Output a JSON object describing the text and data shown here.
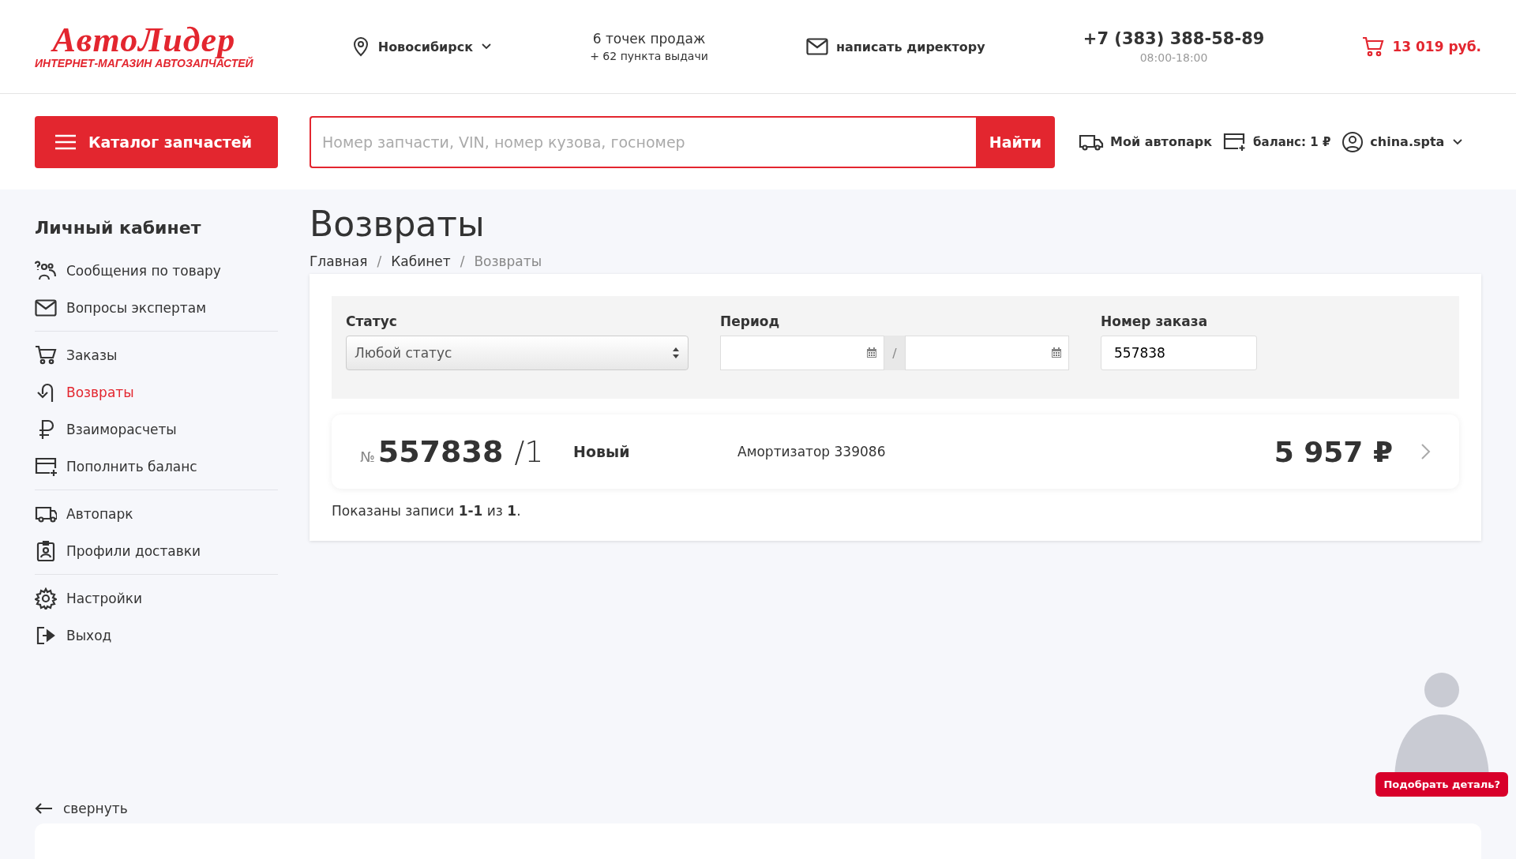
{
  "header": {
    "logo": {
      "name": "АвтоЛидер",
      "tagline": "ИНТЕРНЕТ-МАГАЗИН АВТОЗАПЧАСТЕЙ"
    },
    "city": "Новосибирск",
    "stores": {
      "title": "6 точек продаж",
      "subtitle": "+ 62 пункта выдачи"
    },
    "director_link": "написать директору",
    "phone": {
      "number": "+7 (383) 388-58-89",
      "hours": "08:00-18:00"
    },
    "cart": "13 019 руб."
  },
  "toolbar": {
    "catalog_button": "Каталог запчастей",
    "search": {
      "placeholder": "Номер запчасти, VIN, номер кузова, госномер",
      "button": "Найти"
    },
    "garage": "Мой автопарк",
    "balance": "баланс: 1 ₽",
    "user": "china.spta"
  },
  "sidebar": {
    "title": "Личный кабинет",
    "groups": [
      [
        {
          "label": "Сообщения по товару",
          "selected": false
        },
        {
          "label": "Вопросы экспертам",
          "selected": false
        }
      ],
      [
        {
          "label": "Заказы",
          "selected": false
        },
        {
          "label": "Возвраты",
          "selected": true
        },
        {
          "label": "Взаиморасчеты",
          "selected": false
        },
        {
          "label": "Пополнить баланс",
          "selected": false
        }
      ],
      [
        {
          "label": "Автопарк",
          "selected": false
        },
        {
          "label": "Профили доставки",
          "selected": false
        }
      ],
      [
        {
          "label": "Настройки",
          "selected": false
        },
        {
          "label": "Выход",
          "selected": false
        }
      ]
    ],
    "collapse": "свернуть"
  },
  "page": {
    "title": "Возвраты",
    "breadcrumbs": [
      "Главная",
      "Кабинет",
      "Возвраты"
    ],
    "breadcrumb_separator": "/",
    "filters": {
      "status": {
        "label": "Статус",
        "value": "Любой статус"
      },
      "period": {
        "label": "Период",
        "separator": "/"
      },
      "order": {
        "label": "Номер заказа",
        "value": "557838"
      }
    },
    "returns": [
      {
        "number_sign": "№",
        "number": "557838",
        "suffix": "/1",
        "status": "Новый",
        "item": "Амортизатор 339086",
        "amount": "5 957 ₽"
      }
    ],
    "summary": "Показаны записи **1-1** из **1**."
  },
  "helper": {
    "button": "Подобрать деталь?"
  }
}
